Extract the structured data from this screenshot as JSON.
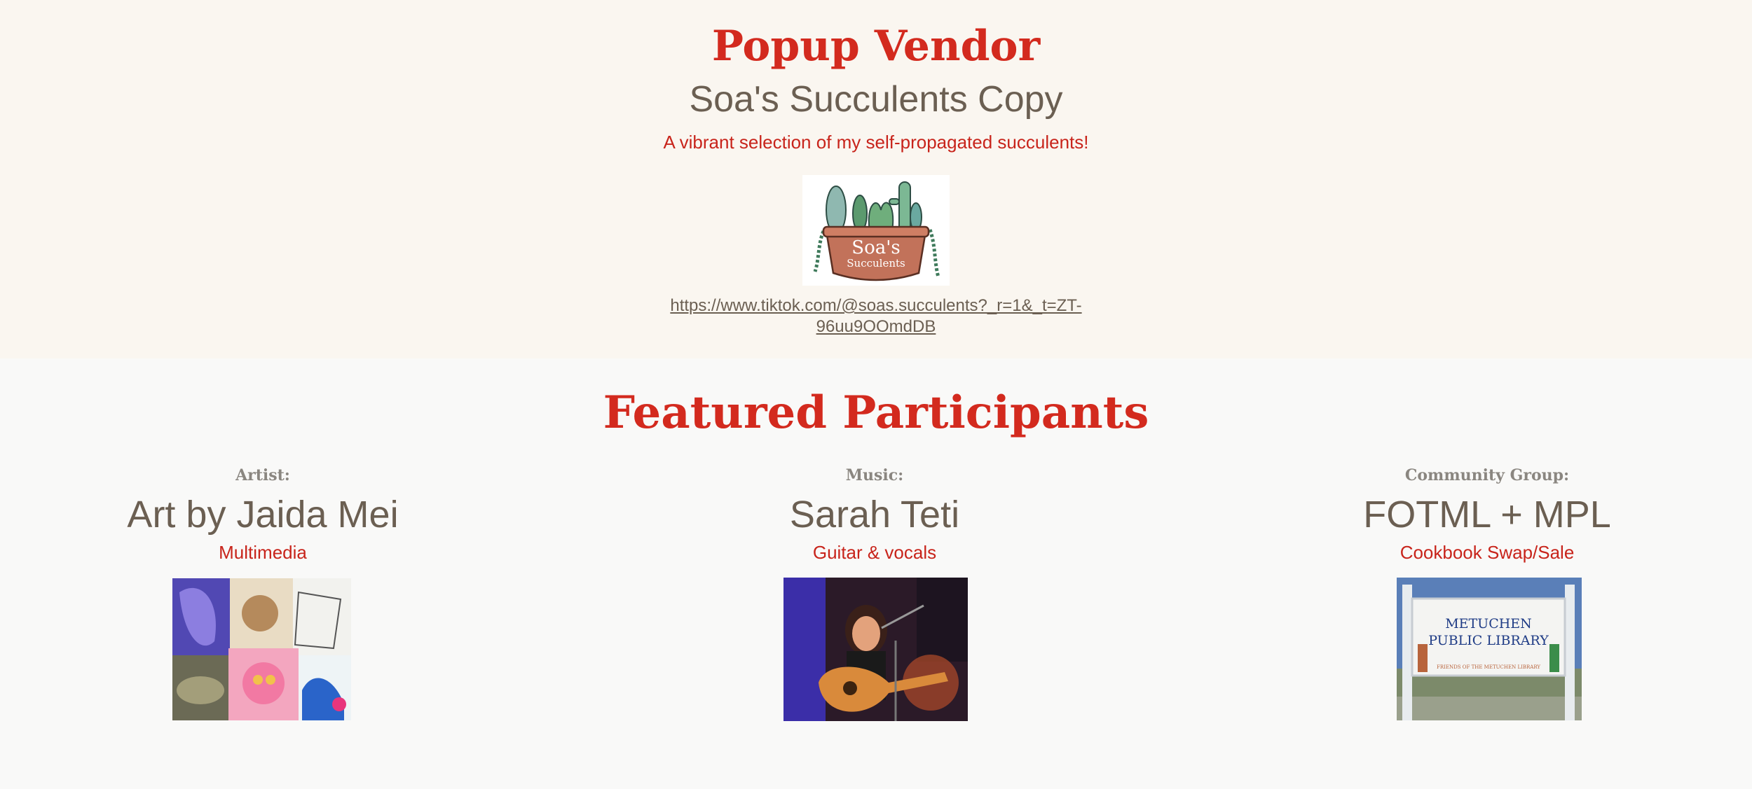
{
  "vendor": {
    "heading": "Popup Vendor",
    "name": "Soa's Succulents Copy",
    "description": "A vibrant selection of my self-propagated succulents!",
    "logo_text_main": "Soa's",
    "logo_text_sub": "Succulents",
    "link": "https://www.tiktok.com/@soas.succulents?_r=1&_t=ZT-96uu9OOmdDB"
  },
  "featured": {
    "heading": "Featured Participants",
    "participants": [
      {
        "category": "Artist:",
        "name": "Art by Jaida Mei",
        "subtitle": "Multimedia"
      },
      {
        "category": "Music:",
        "name": "Sarah Teti",
        "subtitle": "Guitar & vocals"
      },
      {
        "category": "Community Group:",
        "name": "FOTML + MPL",
        "subtitle": "Cookbook Swap/Sale",
        "photo_sign_line1": "METUCHEN",
        "photo_sign_line2": "PUBLIC LIBRARY",
        "photo_sign_line3": "FRIENDS OF THE METUCHEN LIBRARY"
      }
    ]
  },
  "colors": {
    "accent_red": "#d32a1e",
    "text_brown": "#6b5f52",
    "vendor_bg": "#faf6f0",
    "page_bg": "#f9f9f8"
  }
}
